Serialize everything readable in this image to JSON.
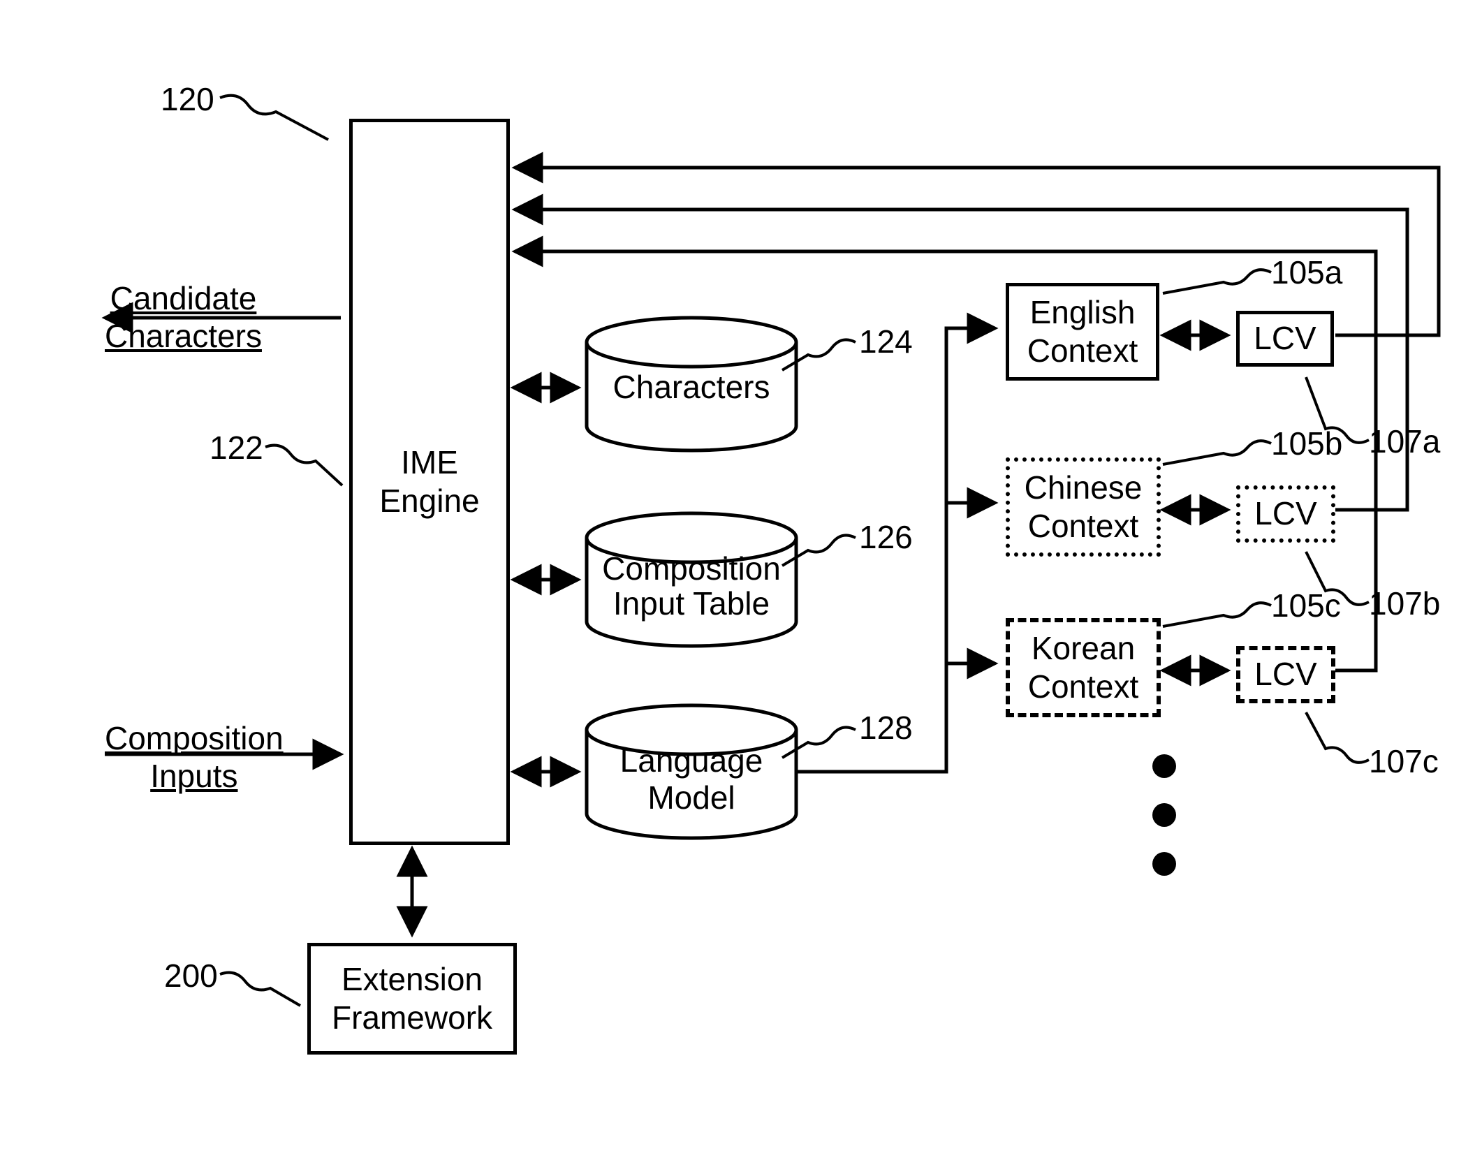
{
  "labels": {
    "fig_ref_120": "120",
    "fig_ref_122": "122",
    "fig_ref_124": "124",
    "fig_ref_126": "126",
    "fig_ref_128": "128",
    "fig_ref_200": "200",
    "fig_ref_105a": "105a",
    "fig_ref_105b": "105b",
    "fig_ref_105c": "105c",
    "fig_ref_107a": "107a",
    "fig_ref_107b": "107b",
    "fig_ref_107c": "107c",
    "candidate_chars": "Candidate\nCharacters",
    "composition_inputs": "Composition\nInputs"
  },
  "boxes": {
    "ime_engine": "IME\nEngine",
    "extension_framework": "Extension\nFramework",
    "english_context": "English\nContext",
    "chinese_context": "Chinese\nContext",
    "korean_context": "Korean\nContext",
    "lcv_a": "LCV",
    "lcv_b": "LCV",
    "lcv_c": "LCV"
  },
  "cylinders": {
    "characters": "Characters",
    "composition_input_table": "Composition\nInput Table",
    "language_model": "Language\nModel"
  }
}
